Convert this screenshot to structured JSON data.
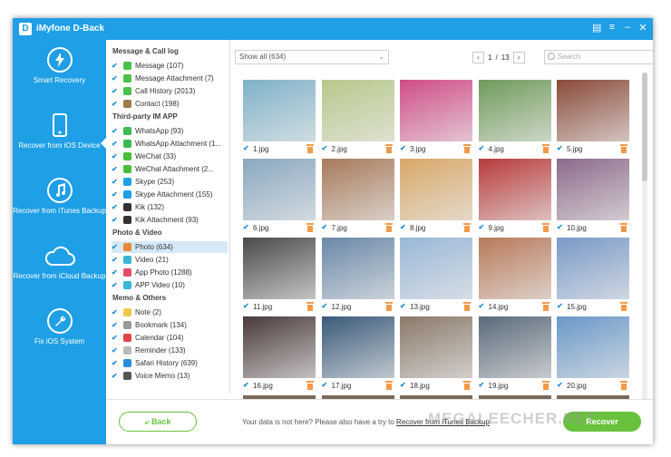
{
  "app": {
    "logo_letter": "D",
    "title": "iMyfone D-Back"
  },
  "window_controls": [
    "feedback-icon",
    "menu-icon",
    "minimize-icon",
    "close-icon"
  ],
  "sidebar": {
    "items": [
      {
        "label": "Smart Recovery",
        "icon": "lightning-icon",
        "active": false
      },
      {
        "label": "Recover from iOS Device",
        "icon": "phone-icon",
        "active": true
      },
      {
        "label": "Recover from iTunes Backup",
        "icon": "music-note-icon",
        "active": false
      },
      {
        "label": "Recover from iCloud Backup",
        "icon": "cloud-icon",
        "active": false
      },
      {
        "label": "Fix iOS System",
        "icon": "wrench-icon",
        "active": false
      }
    ]
  },
  "categories": {
    "groups": [
      {
        "title": "Message & Call log",
        "items": [
          {
            "label": "Message (107)",
            "color": "#4bc14b"
          },
          {
            "label": "Message Attachment (7)",
            "color": "#4bc14b"
          },
          {
            "label": "Call History (2013)",
            "color": "#4bc14b"
          },
          {
            "label": "Contact (198)",
            "color": "#a07a4a"
          }
        ]
      },
      {
        "title": "Third-party IM APP",
        "items": [
          {
            "label": "WhatsApp (93)",
            "color": "#3cba54"
          },
          {
            "label": "WhatsApp Attachment (1...",
            "color": "#3cba54"
          },
          {
            "label": "WeChat (33)",
            "color": "#46c03a"
          },
          {
            "label": "WeChat Attachment (2...",
            "color": "#46c03a"
          },
          {
            "label": "Skype (253)",
            "color": "#1da1e6"
          },
          {
            "label": "Skype Attachment (155)",
            "color": "#1da1e6"
          },
          {
            "label": "Kik (132)",
            "color": "#333333"
          },
          {
            "label": "Kik Attachment (93)",
            "color": "#333333"
          }
        ]
      },
      {
        "title": "Photo & Video",
        "items": [
          {
            "label": "Photo (634)",
            "color": "#e8883a"
          },
          {
            "label": "Video (21)",
            "color": "#39b6d8"
          },
          {
            "label": "App Photo (1288)",
            "color": "#e84a6a"
          },
          {
            "label": "APP Video (10)",
            "color": "#39b6d8"
          }
        ]
      },
      {
        "title": "Memo & Others",
        "items": [
          {
            "label": "Note (2)",
            "color": "#f2c84b"
          },
          {
            "label": "Bookmark (134)",
            "color": "#9a9a9a"
          },
          {
            "label": "Calendar (104)",
            "color": "#e04545"
          },
          {
            "label": "Reminder (133)",
            "color": "#bbbbbb"
          },
          {
            "label": "Safari History (639)",
            "color": "#2a8de0"
          },
          {
            "label": "Voice Memo (13)",
            "color": "#555555"
          }
        ]
      }
    ],
    "selected": "Photo (634)"
  },
  "toolbar": {
    "filter_value": "Show all (634)",
    "page_current": "1",
    "page_sep": "/",
    "page_total": "13",
    "search_placeholder": "Search"
  },
  "photos": [
    {
      "name": "1.jpg",
      "color": "#7fb2c9"
    },
    {
      "name": "2.jpg",
      "color": "#b8c88a"
    },
    {
      "name": "3.jpg",
      "color": "#d04c88"
    },
    {
      "name": "4.jpg",
      "color": "#6f9a5a"
    },
    {
      "name": "5.jpg",
      "color": "#8a4a3a"
    },
    {
      "name": "6.jpg",
      "color": "#8aa8c0"
    },
    {
      "name": "7.jpg",
      "color": "#a77a5a"
    },
    {
      "name": "8.jpg",
      "color": "#d8a868"
    },
    {
      "name": "9.jpg",
      "color": "#b83a3a"
    },
    {
      "name": "10.jpg",
      "color": "#8c6a8a"
    },
    {
      "name": "11.jpg",
      "color": "#4a4a4a"
    },
    {
      "name": "12.jpg",
      "color": "#6a88a8"
    },
    {
      "name": "13.jpg",
      "color": "#9ab8d8"
    },
    {
      "name": "14.jpg",
      "color": "#b87a5a"
    },
    {
      "name": "15.jpg",
      "color": "#7a9ac8"
    },
    {
      "name": "16.jpg",
      "color": "#4a3a3a"
    },
    {
      "name": "17.jpg",
      "color": "#3a5a7a"
    },
    {
      "name": "18.jpg",
      "color": "#8a7a6a"
    },
    {
      "name": "19.jpg",
      "color": "#5a6a7a"
    },
    {
      "name": "20.jpg",
      "color": "#6a98c8"
    }
  ],
  "footer": {
    "back_label": "Back",
    "hint_text": "Your data is not here? Please also have a try to",
    "hint_link": "Recover from iTunes Backup",
    "recover_label": "Recover"
  },
  "watermark": "MEGALEECHER.NET",
  "colors": {
    "brand": "#1e9fe6",
    "accent_green": "#68c23c",
    "trash": "#f39a4a"
  }
}
